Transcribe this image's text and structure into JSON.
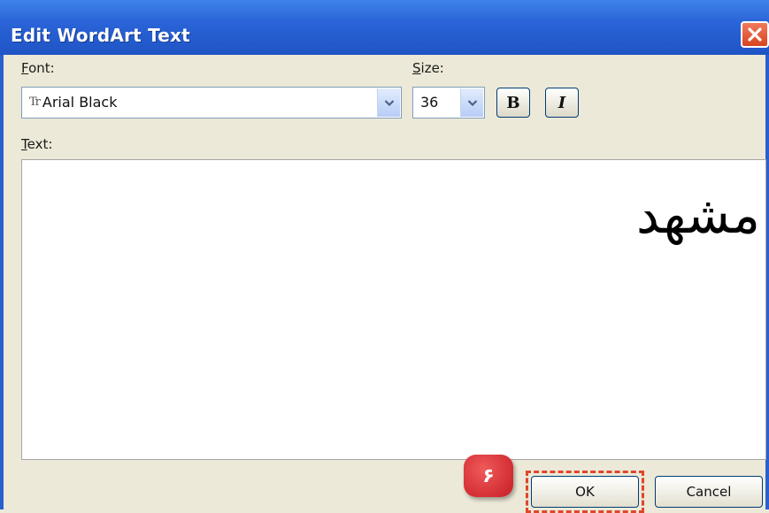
{
  "window": {
    "title": "Edit WordArt Text"
  },
  "font": {
    "label_accel": "F",
    "label_rest": "ont:",
    "value": "Arial Black",
    "font_type_glyph": "Tr"
  },
  "size": {
    "label_accel": "S",
    "label_rest": "ize:",
    "value": "36"
  },
  "format": {
    "bold_label": "B",
    "italic_label": "I"
  },
  "text": {
    "label_accel": "T",
    "label_rest": "ext:",
    "content": "مشهد"
  },
  "buttons": {
    "ok_label": "OK",
    "cancel_label": "Cancel"
  },
  "annotation": {
    "step_number": "۶",
    "highlight_color": "#e0462a",
    "badge_color": "#c71c24"
  },
  "colors": {
    "titlebar": "#2a64d8",
    "dialog_bg": "#ece9d8",
    "close_button": "#d7441f"
  }
}
